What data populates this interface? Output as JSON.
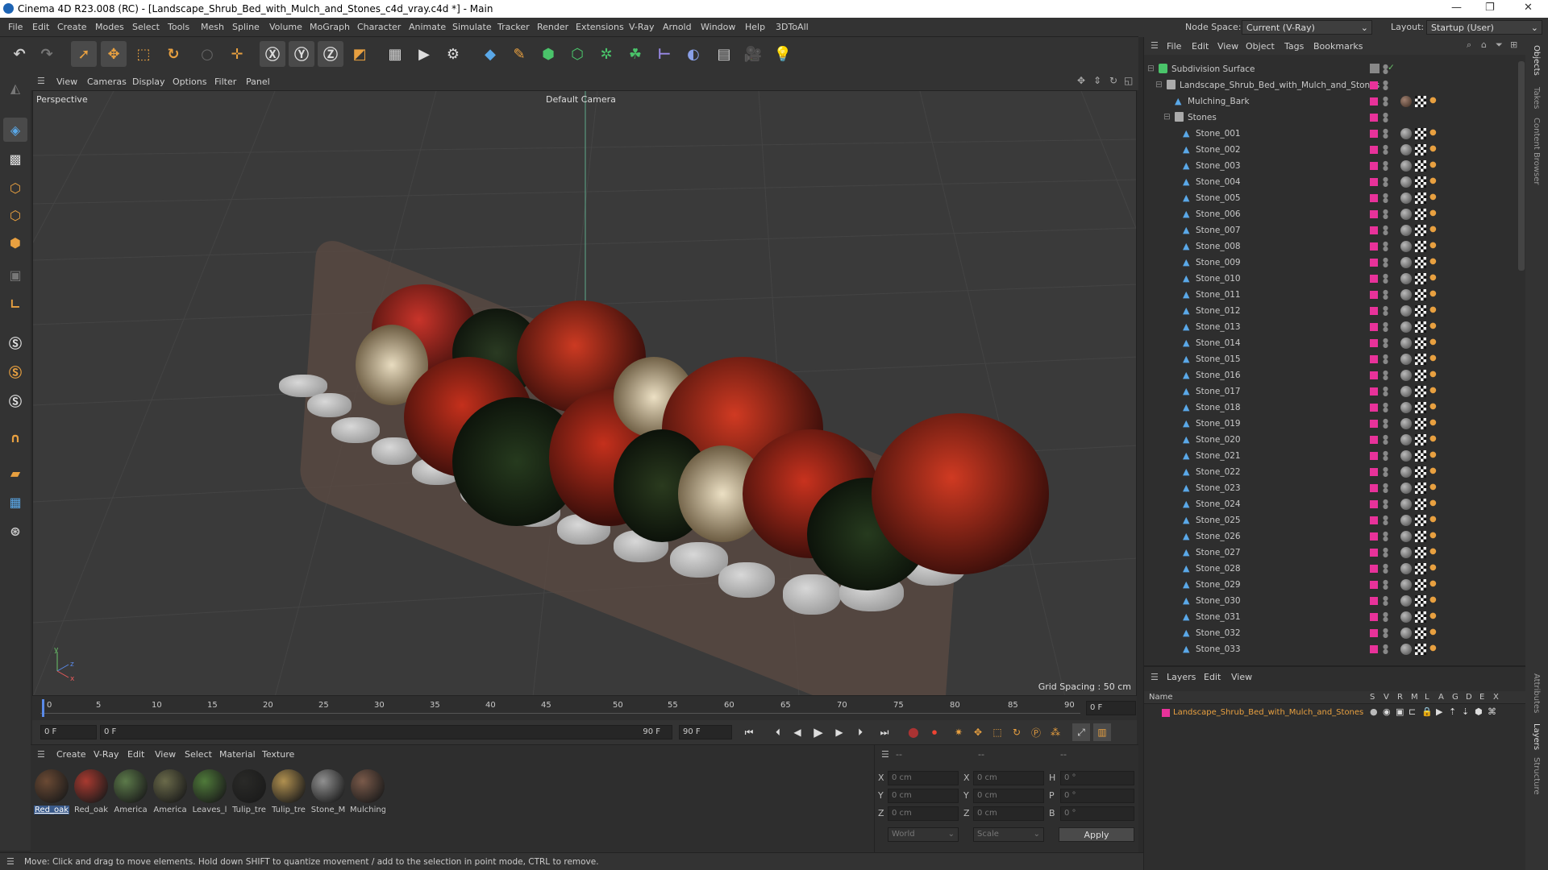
{
  "window": {
    "title": "Cinema 4D R23.008 (RC) - [Landscape_Shrub_Bed_with_Mulch_and_Stones_c4d_vray.c4d *] - Main"
  },
  "menu": [
    "File",
    "Edit",
    "Create",
    "Modes",
    "Select",
    "Tools",
    "Mesh",
    "Spline",
    "Volume",
    "MoGraph",
    "Character",
    "Animate",
    "Simulate",
    "Tracker",
    "Render",
    "Extensions",
    "V-Ray",
    "Arnold",
    "Window",
    "Help",
    "3DToAll"
  ],
  "node_space": {
    "label": "Node Space:",
    "value": "Current (V-Ray)"
  },
  "layout": {
    "label": "Layout:",
    "value": "Startup (User)"
  },
  "viewport_menu": [
    "View",
    "Cameras",
    "Display",
    "Options",
    "Filter",
    "Panel"
  ],
  "viewport": {
    "name": "Perspective",
    "camera": "Default Camera",
    "grid_spacing": "Grid Spacing : 50 cm"
  },
  "timeline": {
    "ticks": [
      "0",
      "5",
      "10",
      "15",
      "20",
      "25",
      "30",
      "35",
      "40",
      "45",
      "50",
      "55",
      "60",
      "65",
      "70",
      "75",
      "80",
      "85",
      "90"
    ],
    "end_field": "0 F"
  },
  "transport": {
    "current": "0 F",
    "start": "0 F",
    "end": "90 F",
    "end2": "90 F"
  },
  "material_menu": [
    "Create",
    "V-Ray",
    "Edit",
    "View",
    "Select",
    "Material",
    "Texture"
  ],
  "materials": [
    {
      "label": "Red_oak",
      "color": "#6b4a34"
    },
    {
      "label": "Red_oak",
      "color": "#a83a30"
    },
    {
      "label": "America",
      "color": "#5c7a4a"
    },
    {
      "label": "America",
      "color": "#6a6a4a"
    },
    {
      "label": "Leaves_l",
      "color": "#4f7a3a"
    },
    {
      "label": "Tulip_tre",
      "color": "#2a2a28"
    },
    {
      "label": "Tulip_tre",
      "color": "#b09050"
    },
    {
      "label": "Stone_M",
      "color": "#909090"
    },
    {
      "label": "Mulching",
      "color": "#7a5a4a"
    }
  ],
  "coords": {
    "header": [
      "--",
      "--",
      "--"
    ],
    "rows": [
      {
        "a": "X",
        "av": "0 cm",
        "b": "X",
        "bv": "0 cm",
        "c": "H",
        "cv": "0 °"
      },
      {
        "a": "Y",
        "av": "0 cm",
        "b": "Y",
        "bv": "0 cm",
        "c": "P",
        "cv": "0 °"
      },
      {
        "a": "Z",
        "av": "0 cm",
        "b": "Z",
        "bv": "0 cm",
        "c": "B",
        "cv": "0 °"
      }
    ],
    "dropdown1": "World",
    "dropdown2": "Scale",
    "apply": "Apply"
  },
  "status": "Move: Click and drag to move elements. Hold down SHIFT to quantize movement / add to the selection in point mode, CTRL to remove.",
  "objects_menu": [
    "File",
    "Edit",
    "View",
    "Object",
    "Tags",
    "Bookmarks"
  ],
  "objects": {
    "root": "Subdivision Surface",
    "group": "Landscape_Shrub_Bed_with_Mulch_and_Stones",
    "mulch": "Mulching_Bark",
    "stones_group": "Stones",
    "stones": [
      "Stone_001",
      "Stone_002",
      "Stone_003",
      "Stone_004",
      "Stone_005",
      "Stone_006",
      "Stone_007",
      "Stone_008",
      "Stone_009",
      "Stone_010",
      "Stone_011",
      "Stone_012",
      "Stone_013",
      "Stone_014",
      "Stone_015",
      "Stone_016",
      "Stone_017",
      "Stone_018",
      "Stone_019",
      "Stone_020",
      "Stone_021",
      "Stone_022",
      "Stone_023",
      "Stone_024",
      "Stone_025",
      "Stone_026",
      "Stone_027",
      "Stone_028",
      "Stone_029",
      "Stone_030",
      "Stone_031",
      "Stone_032",
      "Stone_033"
    ]
  },
  "layers_menu": [
    "Layers",
    "Edit",
    "View"
  ],
  "layers": {
    "col_name": "Name",
    "cols": [
      "S",
      "V",
      "R",
      "M",
      "L",
      "A",
      "G",
      "D",
      "E",
      "X"
    ],
    "row": "Landscape_Shrub_Bed_with_Mulch_and_Stones"
  },
  "right_tabs": [
    "Objects",
    "Takes",
    "Content Browser",
    "Attributes",
    "Layers",
    "Structure"
  ]
}
